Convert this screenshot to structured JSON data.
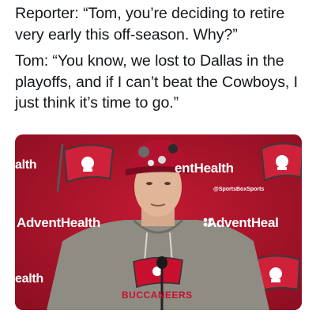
{
  "caption": {
    "reporter_line": "Reporter: “Tom, you’re deciding to retire very early this off-season. Why?”",
    "tom_line": "Tom: “You know, we lost to Dallas in the playoffs, and if I can’t beat the Cowboys, I just think it’s time to go.”"
  },
  "photo": {
    "backdrop_texts": [
      "alth",
      "entHealth",
      "AdventHealth",
      "AdventHeal",
      "ealth"
    ],
    "watermark": "@SportsBoxSports",
    "hoodie_text": "BUCCANEERS"
  },
  "colors": {
    "backdrop_red": "#a8142a",
    "hoodie_gray": "#8e8c83",
    "cap_red": "#b3122f",
    "team_red": "#c8102e"
  }
}
